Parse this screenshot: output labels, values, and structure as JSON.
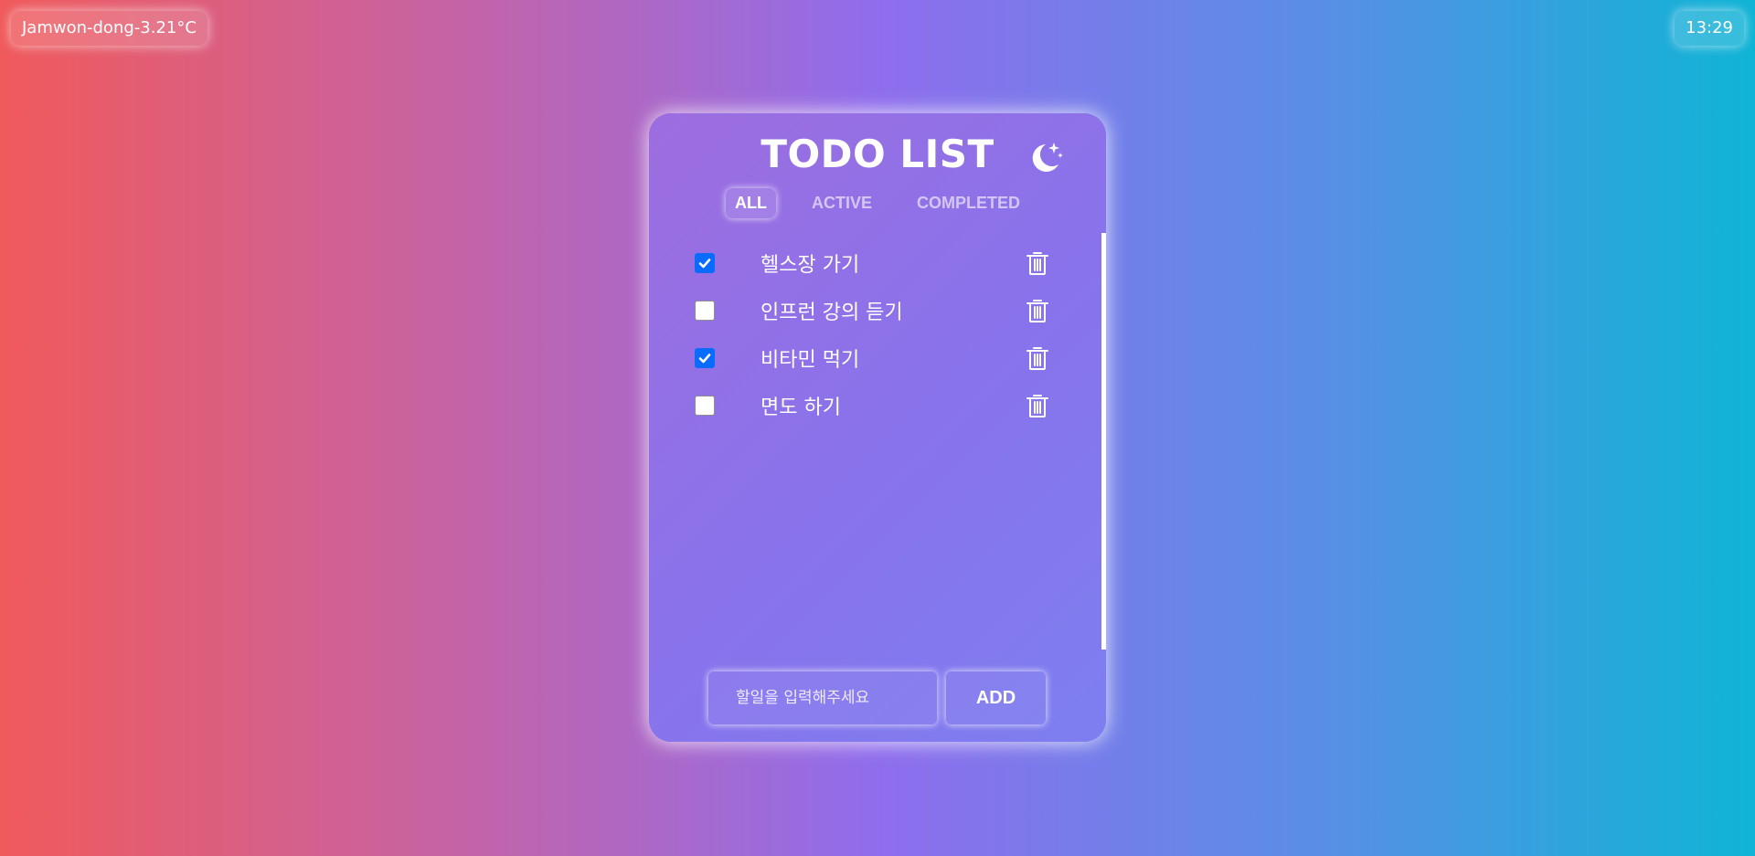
{
  "weather": {
    "label": "Jamwon-dong-3.21°C"
  },
  "clock": {
    "time": "13:29"
  },
  "app": {
    "title": "TODO LIST",
    "theme_toggle_icon": "moon-stars-icon"
  },
  "filters": {
    "tabs": [
      {
        "label": "ALL",
        "active": true
      },
      {
        "label": "ACTIVE",
        "active": false
      },
      {
        "label": "COMPLETED",
        "active": false
      }
    ]
  },
  "todos": [
    {
      "text": "헬스장 가기",
      "completed": true
    },
    {
      "text": "인프런 강의 듣기",
      "completed": false
    },
    {
      "text": "비타민 먹기",
      "completed": true
    },
    {
      "text": "면도 하기",
      "completed": false
    }
  ],
  "form": {
    "placeholder": "할일을 입력해주세요",
    "value": "",
    "add_label": "ADD"
  },
  "colors": {
    "checkbox_checked": "#0a6cff",
    "text": "#ffffff"
  }
}
